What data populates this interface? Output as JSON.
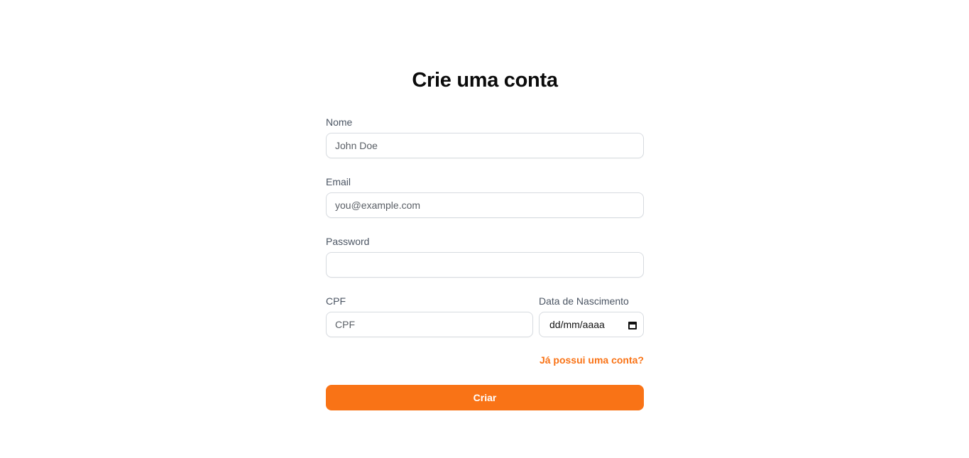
{
  "title": "Crie uma conta",
  "fields": {
    "nome": {
      "label": "Nome",
      "placeholder": "John Doe",
      "value": ""
    },
    "email": {
      "label": "Email",
      "placeholder": "you@example.com",
      "value": ""
    },
    "password": {
      "label": "Password",
      "placeholder": "",
      "value": ""
    },
    "cpf": {
      "label": "CPF",
      "placeholder": "CPF",
      "value": ""
    },
    "nascimento": {
      "label": "Data de Nascimento",
      "display": "dd/mm/aaaa",
      "icon": "calendar-icon"
    }
  },
  "login_link": "Já possui uma conta?",
  "submit_label": "Criar",
  "colors": {
    "accent": "#f97316",
    "label": "#4b5563",
    "border": "#d7dbe0"
  }
}
